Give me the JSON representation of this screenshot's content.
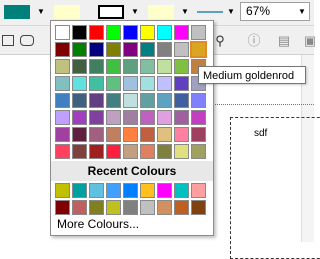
{
  "toolbar": {
    "fill_color": "#00807a",
    "highlight_color": "#ffffcc",
    "border_color": "#000000",
    "bg_color": "#ffffcc",
    "line_color": "#5aa0c8",
    "zoom": "67%"
  },
  "palette": {
    "rows": [
      [
        "#ffffff",
        "#000000",
        "#ff0000",
        "#00ff00",
        "#0000ff",
        "#ffff00",
        "#00ffff",
        "#ff00ff",
        "#c0c0c0"
      ],
      [
        "#800000",
        "#008000",
        "#000080",
        "#808000",
        "#800080",
        "#008080",
        "#808080",
        "#c0c0c0",
        "#d2b48c"
      ],
      [
        "#c0c080",
        "#406040",
        "#408060",
        "#40c040",
        "#60a080",
        "#80c0a0",
        "#c0e0a0",
        "#80c040",
        "#c08040"
      ],
      [
        "#80c0c0",
        "#60e0e0",
        "#40c0a0",
        "#60c080",
        "#a0c0e0",
        "#a0e0e0",
        "#c0c0ff",
        "#6040c0",
        "#a0a0c0"
      ],
      [
        "#4080c0",
        "#406080",
        "#604080",
        "#408080",
        "#c0e0e0",
        "#60a0a0",
        "#60a0c0",
        "#4060a0",
        "#8080ff"
      ],
      [
        "#c0a0ff",
        "#a040c0",
        "#8040a0",
        "#c0a0c0",
        "#a080a0",
        "#c060c0",
        "#e0a0e0",
        "#a060a0",
        "#c040c0"
      ],
      [
        "#a040a0",
        "#602040",
        "#a06080",
        "#c08060",
        "#ff8040",
        "#c06040",
        "#e0c080",
        "#ff80a0",
        "#a04060"
      ],
      [
        "#ff4060",
        "#804040",
        "#a02020",
        "#ff2040",
        "#c0a080",
        "#e08060",
        "#808040",
        "#e0e080",
        "#a0a060"
      ]
    ],
    "selected_color": "#daa520",
    "recent_title": "Recent Colours",
    "recent_rows": [
      [
        "#c0c000",
        "#00a0a0",
        "#60c0e0",
        "#40a0ff",
        "#0080ff",
        "#ffc020",
        "#ff00ff",
        "#00c0c0",
        "#ffa0a0"
      ],
      [
        "#800000",
        "#c06060",
        "#808020",
        "#c0c020",
        "#808080",
        "#c0c0c0",
        "#d09060",
        "#c06020",
        "#804010"
      ]
    ],
    "more_label": "More Colours..."
  },
  "tooltip": "Medium goldenrod",
  "canvas": {
    "text": "sdf"
  }
}
